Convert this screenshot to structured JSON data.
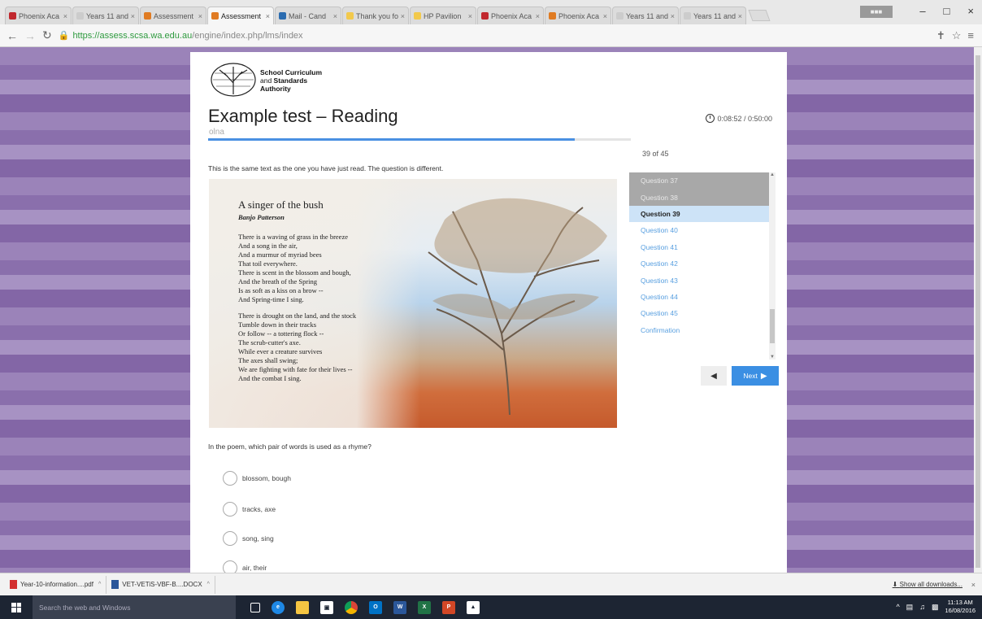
{
  "browser": {
    "tabs": [
      {
        "label": "Phoenix Aca",
        "color": "#c1272d",
        "active": false
      },
      {
        "label": "Years 11 and",
        "color": "#cccccc",
        "active": false
      },
      {
        "label": "Assessment",
        "color": "#e07b22",
        "active": false
      },
      {
        "label": "Assessment",
        "color": "#e07b22",
        "active": true
      },
      {
        "label": "Mail - Cand",
        "color": "#2b6cb0",
        "active": false
      },
      {
        "label": "Thank you fo",
        "color": "#f2c94c",
        "active": false
      },
      {
        "label": "HP Pavilion",
        "color": "#f2c94c",
        "active": false
      },
      {
        "label": "Phoenix Aca",
        "color": "#c1272d",
        "active": false
      },
      {
        "label": "Phoenix Aca",
        "color": "#e07b22",
        "active": false
      },
      {
        "label": "Years 11 and",
        "color": "#cccccc",
        "active": false
      },
      {
        "label": "Years 11 and",
        "color": "#cccccc",
        "active": false
      }
    ],
    "url_domain": "https://assess.scsa.wa.edu.au",
    "url_path": "/engine/index.php/lms/index"
  },
  "header": {
    "logo_line1": "School Curriculum",
    "logo_line2_a": "and ",
    "logo_line2_b": "Standards",
    "logo_line3": "Authority",
    "title": "Example test – Reading",
    "subtitle": "olna",
    "timer": "0:08:52 / 0:50:00",
    "progress_fraction": 0.867,
    "count": "39 of 45"
  },
  "instruction": "This is the same text as the one you have just read. The question is different.",
  "poem": {
    "title": "A singer of the bush",
    "author": "Banjo Patterson",
    "stanza1": [
      "There is a waving of grass in the breeze",
      "And a song in the air,",
      "And a murmur of myriad bees",
      "That toil everywhere.",
      "There is scent in the blossom and bough,",
      "And the breath of the Spring",
      "Is as soft as a kiss on a brow --",
      "And Spring-time I sing."
    ],
    "stanza2": [
      "There is drought on the land, and the stock",
      "Tumble down in their tracks",
      "Or follow -- a tottering flock --",
      "The scrub-cutter's axe.",
      "While ever a creature survives",
      "The axes shall swing;",
      "We are fighting with fate for their lives --",
      "And the combat I sing."
    ]
  },
  "question_list": [
    {
      "label": "Question 37",
      "state": "done"
    },
    {
      "label": "Question 38",
      "state": "done"
    },
    {
      "label": "Question 39",
      "state": "current"
    },
    {
      "label": "Question 40",
      "state": "todo"
    },
    {
      "label": "Question 41",
      "state": "todo"
    },
    {
      "label": "Question 42",
      "state": "todo"
    },
    {
      "label": "Question 43",
      "state": "todo"
    },
    {
      "label": "Question 44",
      "state": "todo"
    },
    {
      "label": "Question 45",
      "state": "todo"
    },
    {
      "label": "Confirmation",
      "state": "todo"
    }
  ],
  "nav": {
    "next_label": "Next"
  },
  "question": "In the poem, which pair of words is used as a rhyme?",
  "options": [
    "blossom, bough",
    "tracks, axe",
    "song, sing",
    "air, their"
  ],
  "downloads": {
    "items": [
      "Year-10-information....pdf",
      "VET-VETiS-VBF-B....DOCX"
    ],
    "show_all": "Show all downloads..."
  },
  "taskbar": {
    "search_placeholder": "Search the web and Windows",
    "time": "11:13 AM",
    "date": "16/08/2016"
  }
}
